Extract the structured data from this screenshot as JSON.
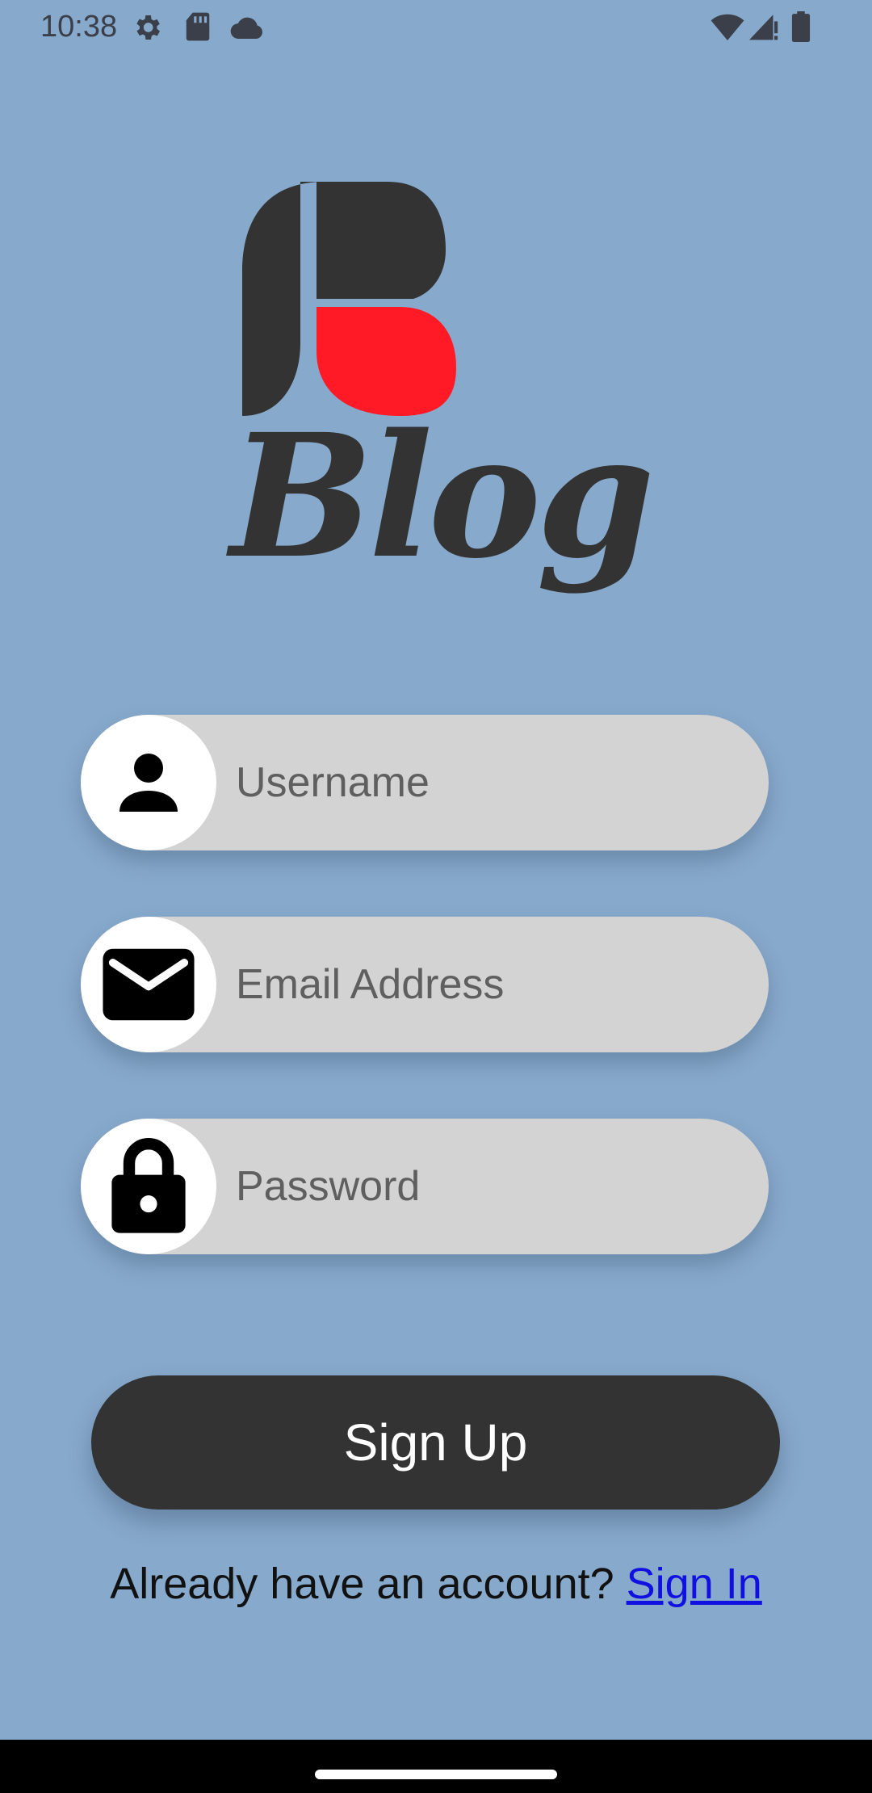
{
  "status_bar": {
    "time": "10:38",
    "icons_left": [
      "settings-icon",
      "sd-card-icon",
      "cloud-icon"
    ],
    "icons_right": [
      "wifi-icon",
      "signal-icon",
      "battery-icon"
    ]
  },
  "logo": {
    "text": "Blog",
    "colors": {
      "dark": "#333333",
      "accent": "#FF1A26"
    }
  },
  "form": {
    "username": {
      "placeholder": "Username",
      "value": "",
      "icon": "person-icon"
    },
    "email": {
      "placeholder": "Email Address",
      "value": "",
      "icon": "mail-icon"
    },
    "password": {
      "placeholder": "Password",
      "value": "",
      "icon": "lock-icon"
    }
  },
  "signup_button": {
    "label": "Sign Up"
  },
  "signin": {
    "prompt": "Already have an account?",
    "link_label": "Sign In"
  },
  "colors": {
    "background": "#87A9CB",
    "field": "#D3D3D3",
    "button": "#333333",
    "link": "#1010E0"
  }
}
